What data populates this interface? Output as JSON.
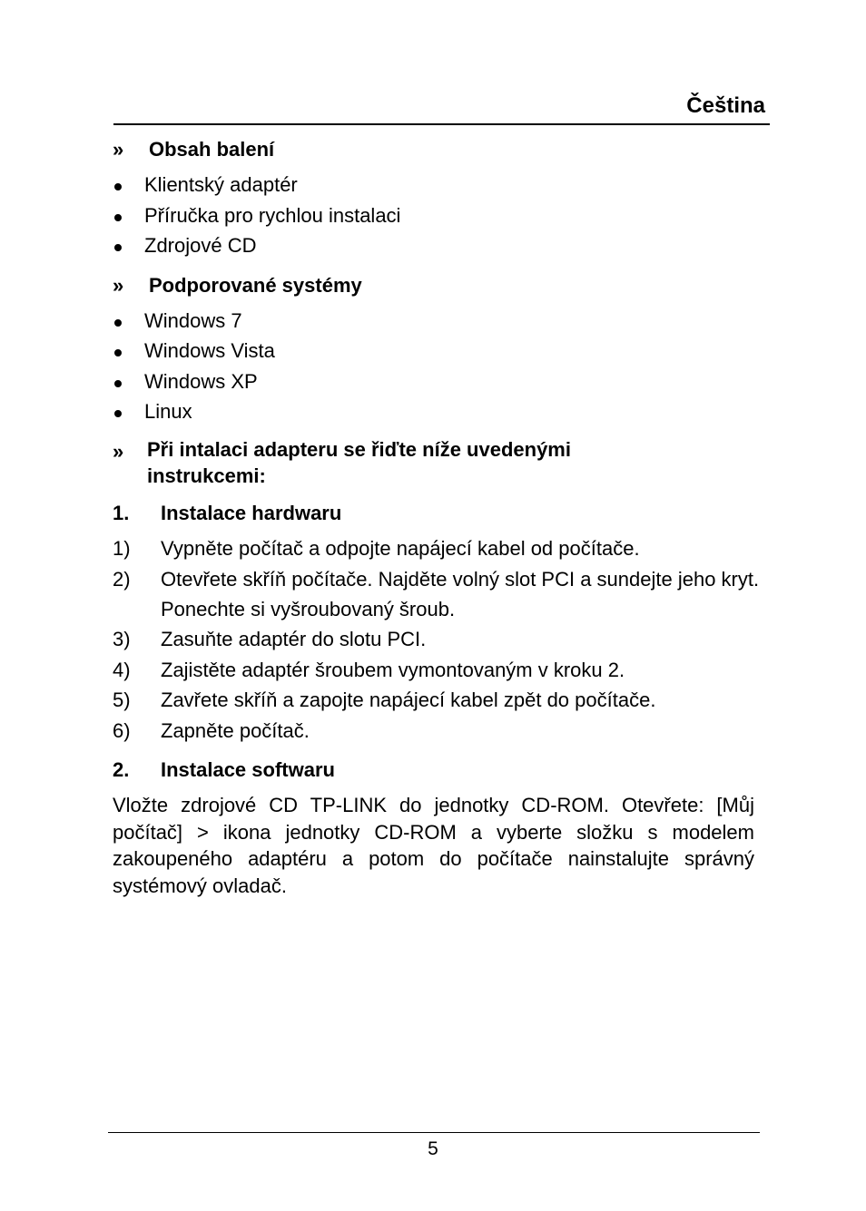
{
  "header": {
    "language": "Čeština"
  },
  "sections": {
    "package": {
      "marker": "»",
      "title": "Obsah balení",
      "items": [
        "Klientský adaptér",
        "Příručka pro rychlou instalaci",
        "Zdrojové CD"
      ]
    },
    "systems": {
      "marker": "»",
      "title": "Podporované systémy",
      "items": [
        "Windows 7",
        "Windows Vista",
        "Windows XP",
        "Linux"
      ]
    },
    "instructions": {
      "marker": "»",
      "title": "Při intalaci adapteru se řiďte níže uvedenými instrukcemi:"
    },
    "hardware": {
      "number": "1.",
      "title": "Instalace hardwaru",
      "steps": [
        {
          "n": "1)",
          "text": "Vypněte počítač a odpojte napájecí kabel od počítače."
        },
        {
          "n": "2)",
          "text": "Otevřete skříň počítače. Najděte volný slot PCI a sundejte jeho kryt. Ponechte si vyšroubovaný šroub."
        },
        {
          "n": "3)",
          "text": "Zasuňte adaptér do slotu PCI."
        },
        {
          "n": "4)",
          "text": "Zajistěte adaptér šroubem vymontovaným v kroku 2."
        },
        {
          "n": "5)",
          "text": "Zavřete skříň a zapojte napájecí kabel zpět do počítače."
        },
        {
          "n": "6)",
          "text": "Zapněte počítač."
        }
      ]
    },
    "software": {
      "number": "2.",
      "title": "Instalace softwaru",
      "paragraph": "Vložte zdrojové CD TP-LINK do jednotky CD-ROM. Otevřete: [Můj počítač] > ikona jednotky CD-ROM a vyberte složku s modelem zakoupeného adaptéru a potom do počítače nainstalujte správný systémový ovladač."
    }
  },
  "footer": {
    "page_number": "5"
  }
}
